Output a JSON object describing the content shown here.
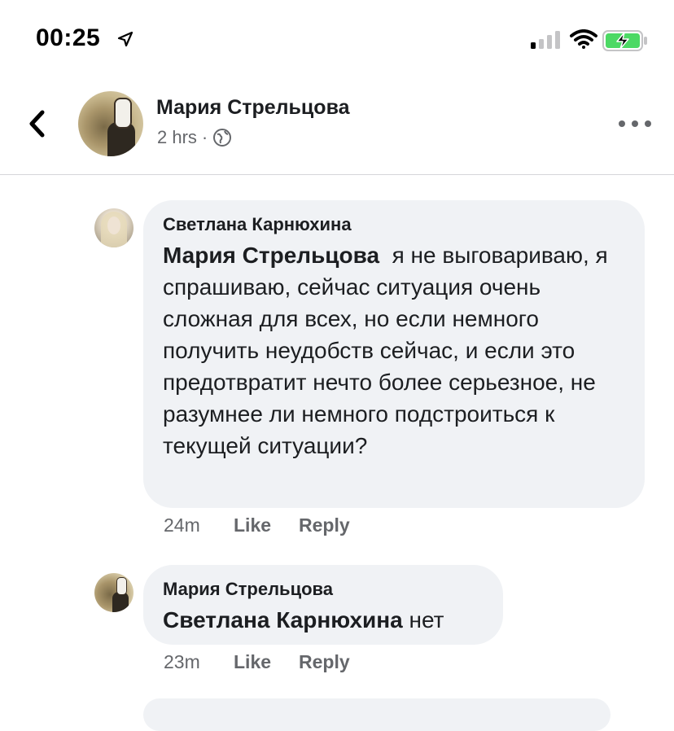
{
  "status_bar": {
    "time": "00:25",
    "location_icon": "location-arrow-icon",
    "signal_icon": "cellular-signal-icon",
    "wifi_icon": "wifi-icon",
    "battery_icon": "battery-charging-icon"
  },
  "header": {
    "author_name": "Мария Стрельцова",
    "time_ago": "2 hrs",
    "separator": "·",
    "privacy_icon": "globe-icon"
  },
  "comments": [
    {
      "author": "Светлана Карнюхина",
      "mention": "Мария Стрельцова",
      "text": "я не выговариваю, я спрашиваю, сейчас ситуация очень сложная для всех, но если немного получить неудобств сейчас, и если это предотвратит нечто более серьезное, не разумнее ли немного подстроиться к текущей ситуации?",
      "time": "24m",
      "like_label": "Like",
      "reply_label": "Reply"
    },
    {
      "author": "Мария Стрельцова",
      "mention": "Светлана Карнюхина",
      "text": "нет",
      "time": "23m",
      "like_label": "Like",
      "reply_label": "Reply"
    }
  ],
  "colors": {
    "bubble_bg": "#f0f2f5",
    "secondary_text": "#65676b",
    "primary_text": "#1c1e21",
    "battery_green": "#4cd964"
  }
}
